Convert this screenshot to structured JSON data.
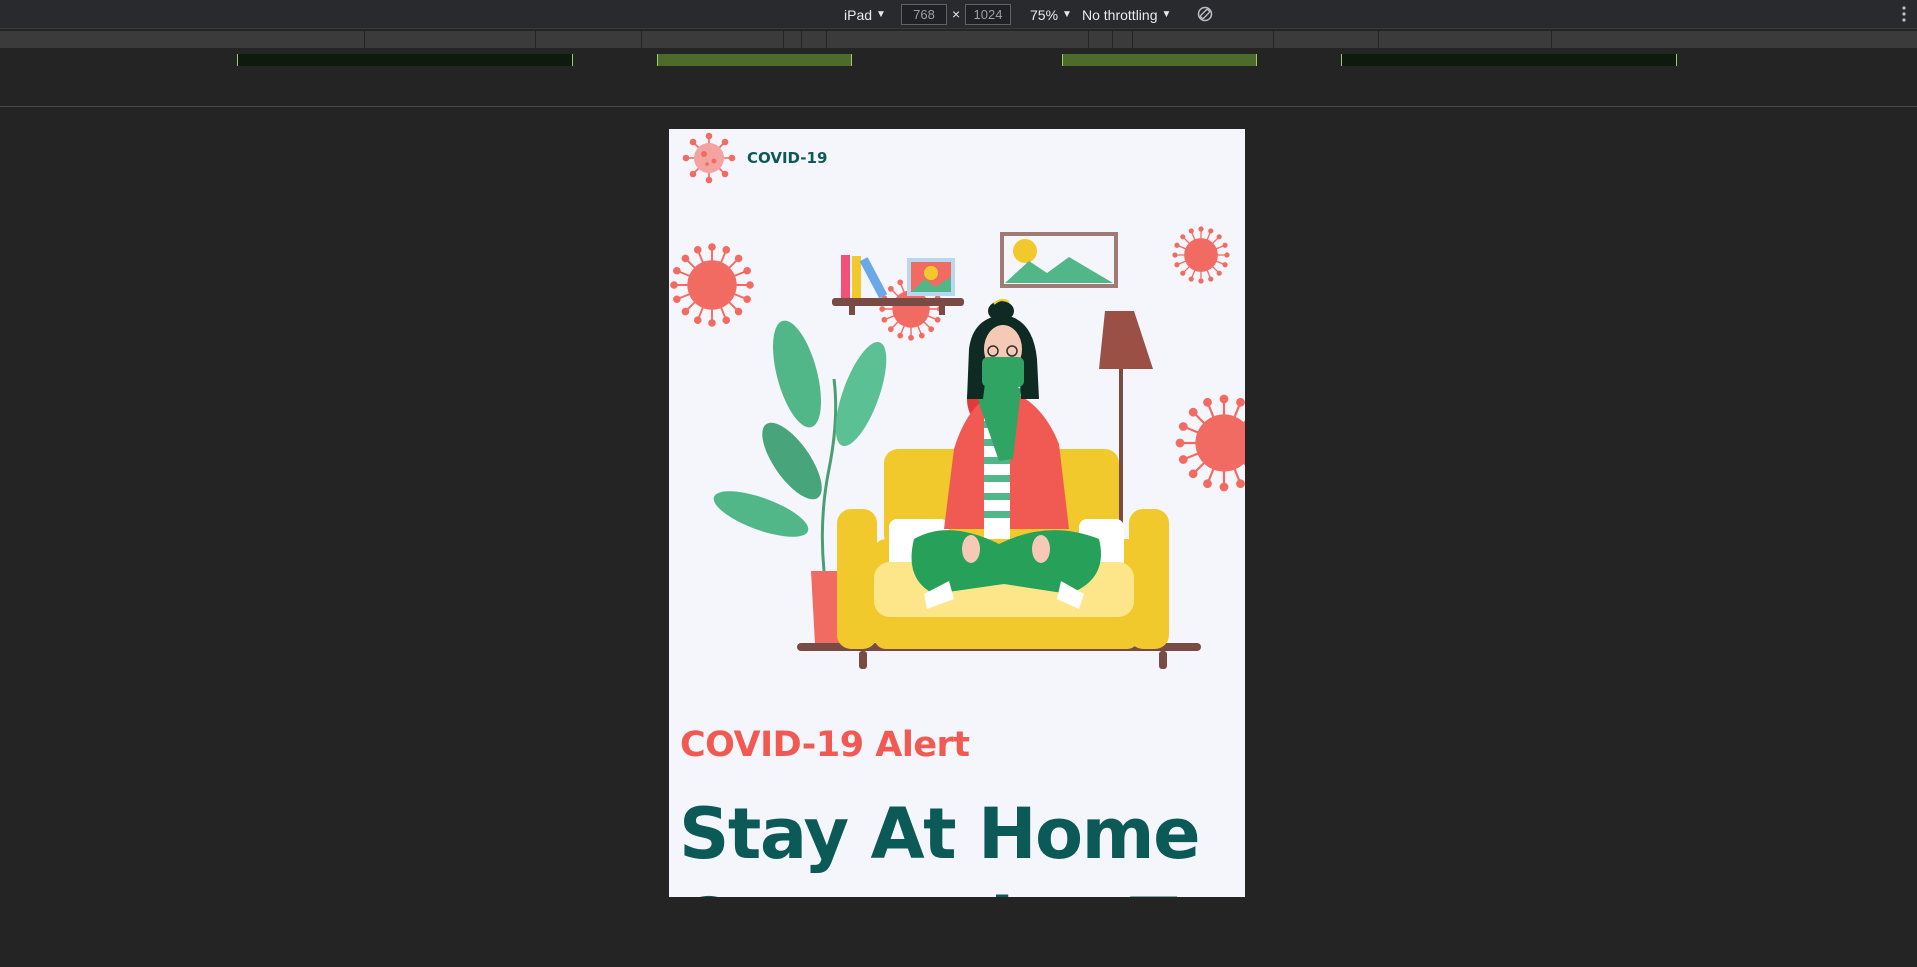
{
  "toolbar": {
    "device_label": "iPad",
    "width_value": "768",
    "height_value": "1024",
    "times_symbol": "×",
    "zoom_label": "75%",
    "throttle_label": "No throttling",
    "icons": [
      "caret-down-icon",
      "rotate-icon",
      "more-options-icon"
    ]
  },
  "page": {
    "brand": {
      "logo_icon": "virus-icon",
      "label": "COVID-19"
    },
    "alert": "COVID-19 Alert",
    "headline": "Stay At Home Quarantine To"
  },
  "colors": {
    "brand_teal": "#0b5a57",
    "alert_red": "#f05a52",
    "virus_red": "#f26b63",
    "sofa_yellow": "#f2c92d",
    "leaf_green": "#52b788",
    "page_bg": "#f5f6fb",
    "devtools_bg": "#242424"
  }
}
